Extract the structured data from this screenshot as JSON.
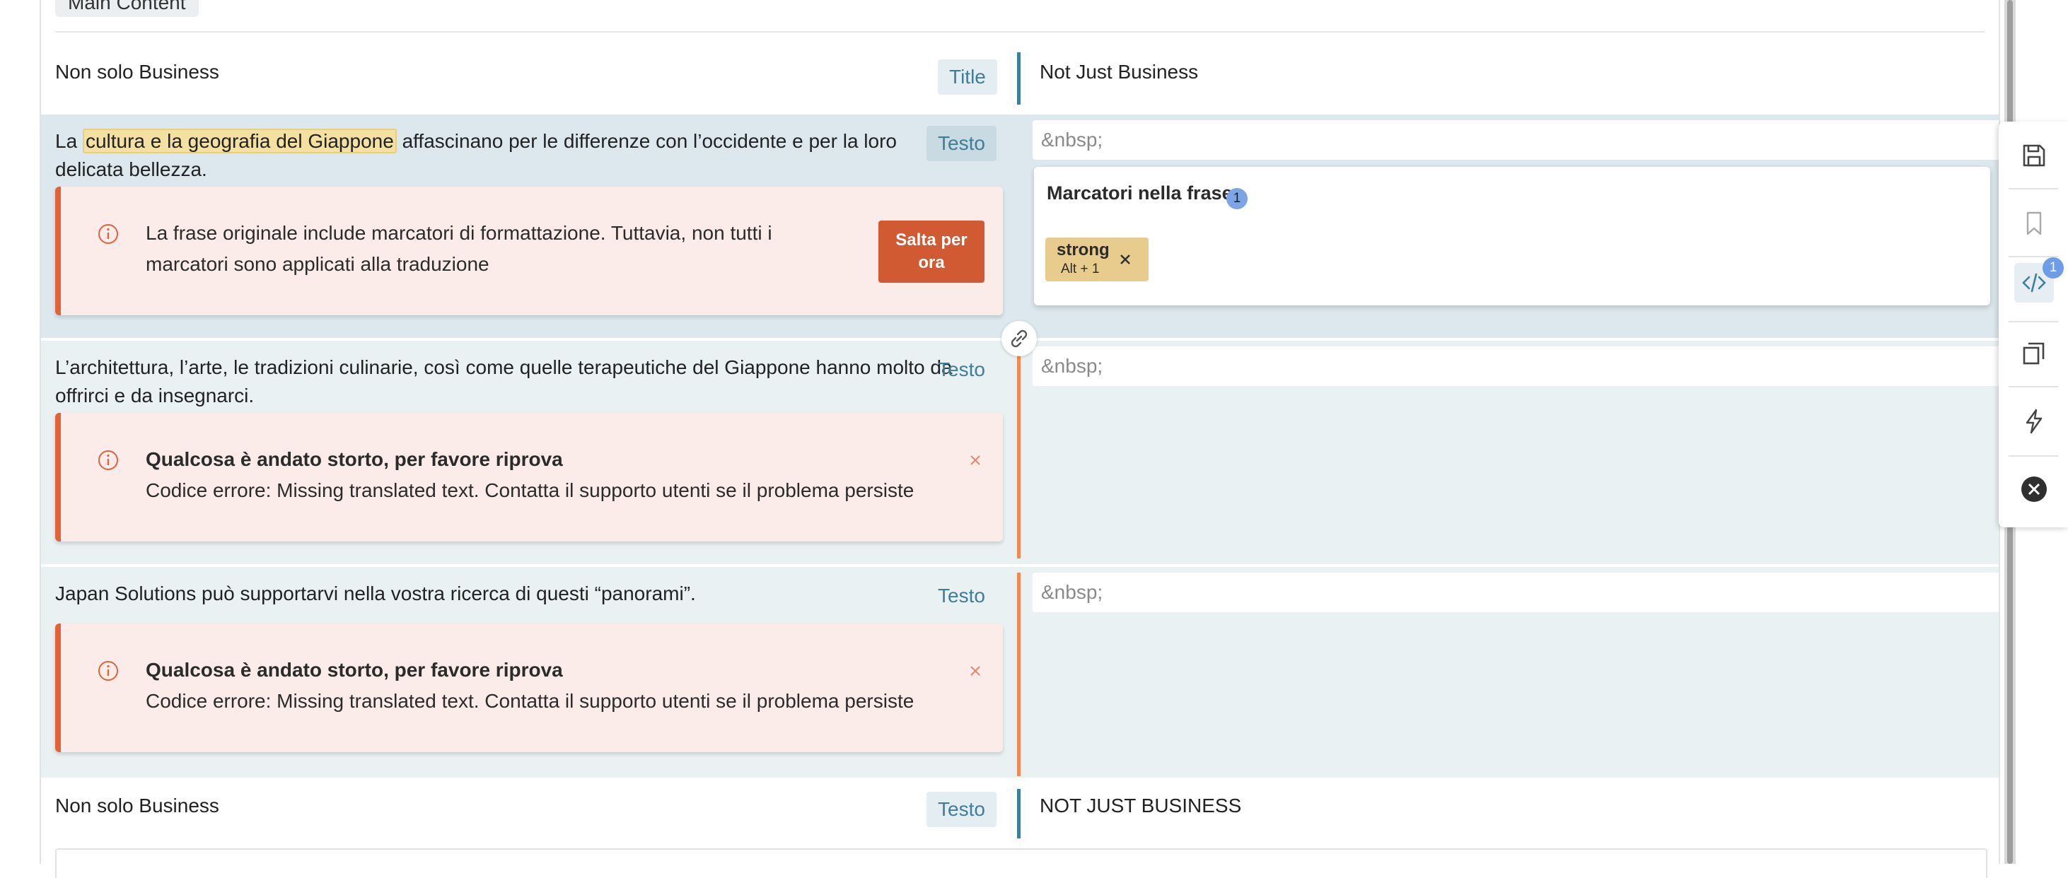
{
  "section_label": "Main Content",
  "rows": [
    {
      "source": "Non solo Business",
      "tag": "Title",
      "target": "Not Just Business"
    },
    {
      "source_before": "La ",
      "source_highlight": "cultura e la geografia del Giappone",
      "source_after": " affascinano per le differenze con l’occidente e per la loro delicata bellezza.",
      "tag": "Testo",
      "target_placeholder": "&nbsp;",
      "alert": {
        "message": "La frase originale include marcatori di formattazione. Tuttavia, non tutti i marcatori sono applicati alla traduzione",
        "skip_line1": "Salta per",
        "skip_line2": "ora"
      }
    },
    {
      "source": "L’architettura, l’arte, le tradizioni culinarie, così come quelle terapeutiche del Giappone hanno molto da offrirci e da insegnarci.",
      "tag": "Testo",
      "target_placeholder": "&nbsp;",
      "alert": {
        "title": "Qualcosa è andato storto, per favore riprova",
        "body": "Codice errore: Missing translated text. Contatta il supporto utenti se il problema persiste"
      }
    },
    {
      "source": "Japan Solutions può supportarvi nella vostra ricerca di questi “panorami”.",
      "tag": "Testo",
      "target_placeholder": "&nbsp;",
      "alert": {
        "title": "Qualcosa è andato storto, per favore riprova",
        "body": "Codice errore: Missing translated text. Contatta il supporto utenti se il problema persiste"
      }
    },
    {
      "source": "Non solo Business",
      "tag": "Testo",
      "target": "NOT JUST BUSINESS"
    }
  ],
  "tag_panel": {
    "title": "Marcatori nella frase",
    "count": "1",
    "chip_name": "strong",
    "chip_shortcut": "Alt + 1"
  },
  "sidebar": {
    "items": [
      "save-icon",
      "bookmark-icon",
      "code-tags-icon",
      "copy-icon",
      "flash-icon",
      "close-circle-icon"
    ],
    "code_badge": "1"
  },
  "colors": {
    "accent_blue": "#3e7f9c",
    "error_orange": "#e0633a",
    "highlight": "#f4e1a2",
    "skip_button": "#d25a32"
  }
}
